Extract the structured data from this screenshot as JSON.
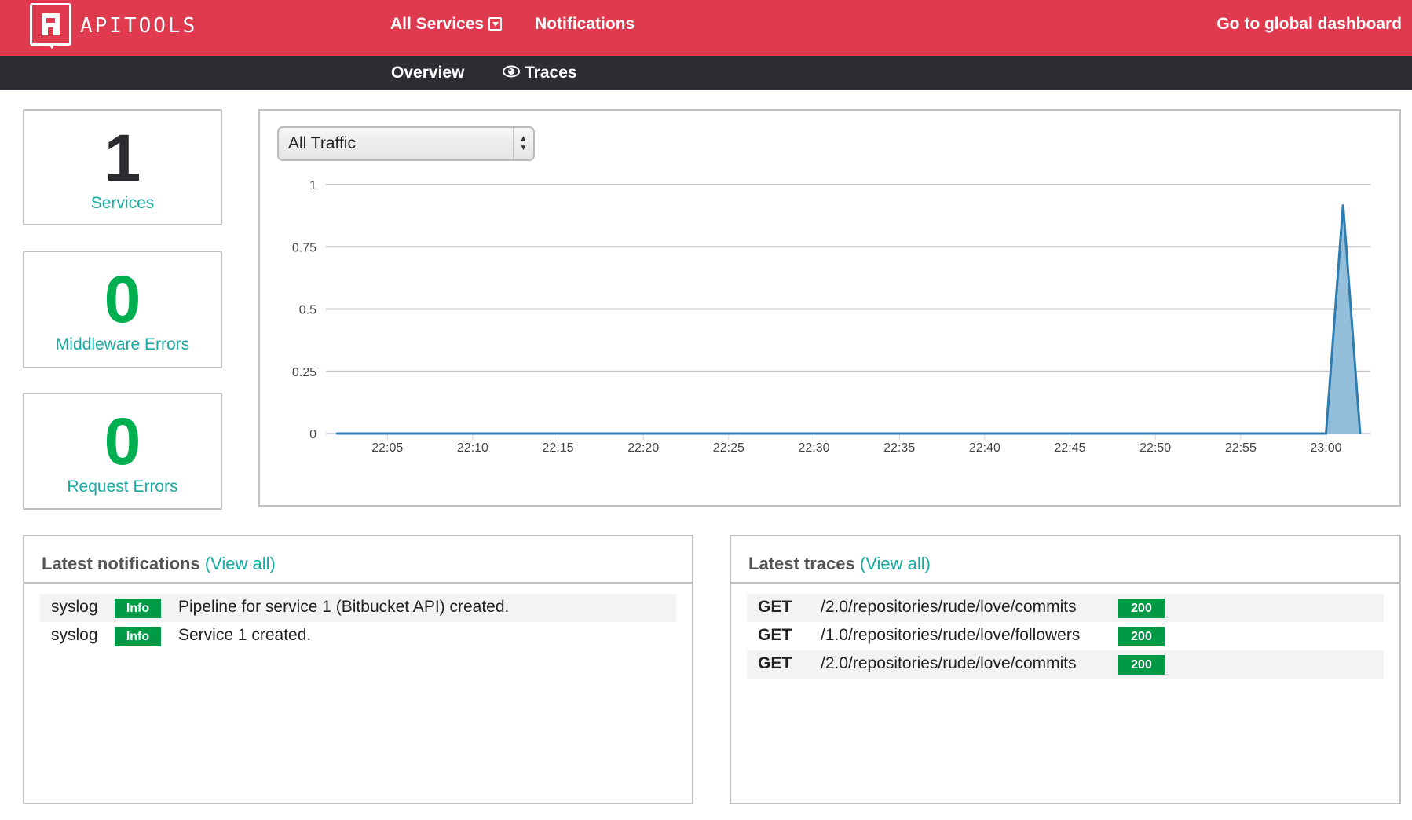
{
  "header": {
    "brand": "APITOOLS",
    "nav": {
      "all_services": "All Services",
      "notifications": "Notifications",
      "global_dashboard": "Go to global dashboard"
    },
    "subnav": {
      "overview": "Overview",
      "traces": "Traces"
    }
  },
  "stats": [
    {
      "value": "1",
      "label": "Services",
      "color": "#2b2a2e"
    },
    {
      "value": "0",
      "label": "Middleware Errors",
      "color": "#00b050"
    },
    {
      "value": "0",
      "label": "Request Errors",
      "color": "#00b050"
    }
  ],
  "traffic_select": {
    "value": "All Traffic"
  },
  "chart_data": {
    "type": "area",
    "title": "",
    "xlabel": "",
    "ylabel": "",
    "ylim": [
      0,
      1
    ],
    "xlim": [
      "22:01:24",
      "23:02:36"
    ],
    "yticks": [
      "0",
      "0.25",
      "0.5",
      "0.75",
      "1"
    ],
    "xticks": [
      "22:05",
      "22:10",
      "22:15",
      "22:20",
      "22:25",
      "22:30",
      "22:35",
      "22:40",
      "22:45",
      "22:50",
      "22:55",
      "23:00"
    ],
    "grid": true,
    "series": [
      {
        "name": "All Traffic",
        "color": "#2f7cb0",
        "fill": "#94bfdb",
        "x": [
          "22:02",
          "23:00",
          "23:01",
          "23:02"
        ],
        "y": [
          0,
          0,
          0.92,
          0
        ]
      }
    ]
  },
  "notifications": {
    "title": "Latest notifications",
    "view_all": "(View all)",
    "items": [
      {
        "source": "syslog",
        "level": "Info",
        "message": "Pipeline for service 1 (Bitbucket API) created."
      },
      {
        "source": "syslog",
        "level": "Info",
        "message": "Service 1 created."
      }
    ]
  },
  "traces": {
    "title": "Latest traces",
    "view_all": "(View all)",
    "items": [
      {
        "method": "GET",
        "path": "/2.0/repositories/rude/love/commits",
        "status": "200"
      },
      {
        "method": "GET",
        "path": "/1.0/repositories/rude/love/followers",
        "status": "200"
      },
      {
        "method": "GET",
        "path": "/2.0/repositories/rude/love/commits",
        "status": "200"
      }
    ]
  }
}
